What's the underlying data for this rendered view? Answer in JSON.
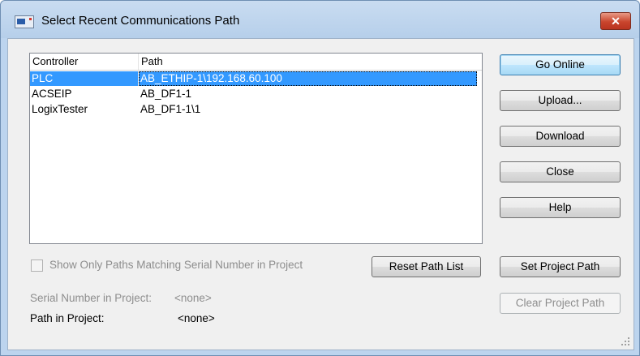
{
  "window": {
    "title": "Select Recent Communications Path",
    "close_glyph": "✕"
  },
  "list": {
    "columns": [
      "Controller",
      "Path"
    ],
    "rows": [
      {
        "controller": "PLC",
        "path": "AB_ETHIP-1\\192.168.60.100",
        "selected": true
      },
      {
        "controller": "ACSEIP",
        "path": "AB_DF1-1",
        "selected": false
      },
      {
        "controller": "LogixTester",
        "path": "AB_DF1-1\\1",
        "selected": false
      }
    ]
  },
  "buttons": {
    "go_online": "Go Online",
    "upload": "Upload...",
    "download": "Download",
    "close": "Close",
    "help": "Help",
    "reset_path_list": "Reset Path List",
    "set_project_path": "Set Project Path",
    "clear_project_path": "Clear Project Path"
  },
  "options": {
    "show_only_matching_label": "Show Only Paths Matching Serial Number in Project",
    "show_only_matching_checked": false
  },
  "info": {
    "serial_number_label": "Serial Number in Project:",
    "serial_number_value": "<none>",
    "path_label": "Path in Project:",
    "path_value": "<none>"
  },
  "colors": {
    "selection": "#3399ff",
    "titlebar": "#bcd4ee",
    "close_button": "#c9452d"
  }
}
